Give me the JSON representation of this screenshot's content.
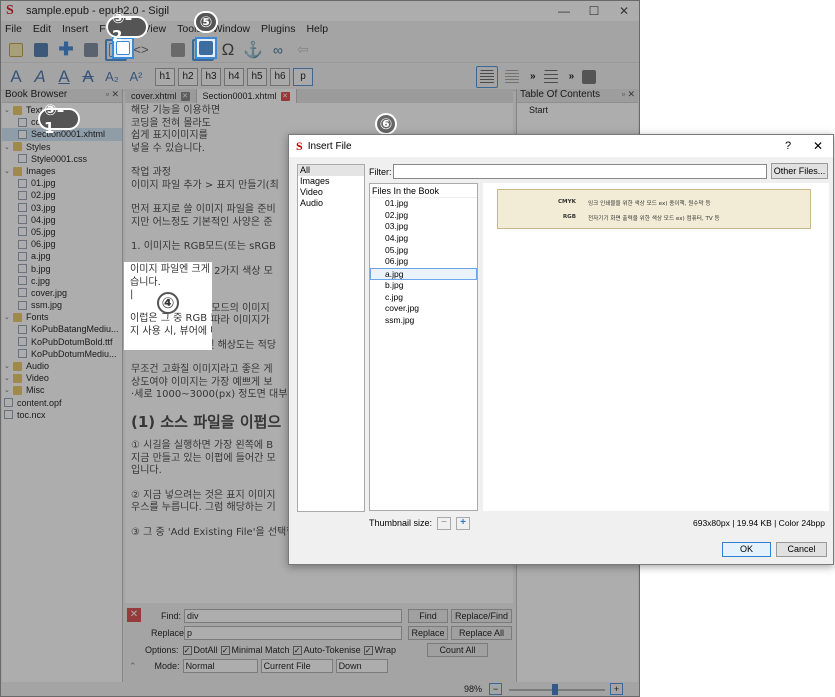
{
  "window": {
    "title": "sample.epub - epub2.0 - Sigil",
    "minimize": "—",
    "maximize": "☐",
    "close": "✕"
  },
  "menu": [
    "File",
    "Edit",
    "Insert",
    "Format",
    "View",
    "Tools",
    "Window",
    "Plugins",
    "Help"
  ],
  "toolbar2": {
    "headings": [
      "h1",
      "h2",
      "h3",
      "h4",
      "h5",
      "h6",
      "p"
    ]
  },
  "book_browser": {
    "title": "Book Browser",
    "items": [
      {
        "label": "Text",
        "type": "folder",
        "level": 0
      },
      {
        "label": "cover.xhtml",
        "type": "file",
        "level": 1
      },
      {
        "label": "Section0001.xhtml",
        "type": "file",
        "level": 1,
        "selected": true
      },
      {
        "label": "Styles",
        "type": "folder",
        "level": 0
      },
      {
        "label": "Style0001.css",
        "type": "file",
        "level": 1
      },
      {
        "label": "Images",
        "type": "folder",
        "level": 0
      },
      {
        "label": "01.jpg",
        "type": "file",
        "level": 1
      },
      {
        "label": "02.jpg",
        "type": "file",
        "level": 1
      },
      {
        "label": "03.jpg",
        "type": "file",
        "level": 1
      },
      {
        "label": "04.jpg",
        "type": "file",
        "level": 1
      },
      {
        "label": "05.jpg",
        "type": "file",
        "level": 1
      },
      {
        "label": "06.jpg",
        "type": "file",
        "level": 1
      },
      {
        "label": "a.jpg",
        "type": "file",
        "level": 1
      },
      {
        "label": "b.jpg",
        "type": "file",
        "level": 1
      },
      {
        "label": "c.jpg",
        "type": "file",
        "level": 1
      },
      {
        "label": "cover.jpg",
        "type": "file",
        "level": 1
      },
      {
        "label": "ssm.jpg",
        "type": "file",
        "level": 1
      },
      {
        "label": "Fonts",
        "type": "folder",
        "level": 0
      },
      {
        "label": "KoPubBatangMediu...",
        "type": "file",
        "level": 1
      },
      {
        "label": "KoPubDotumBold.ttf",
        "type": "file",
        "level": 1
      },
      {
        "label": "KoPubDotumMediu...",
        "type": "file",
        "level": 1
      },
      {
        "label": "Audio",
        "type": "folder",
        "level": 0
      },
      {
        "label": "Video",
        "type": "folder",
        "level": 0
      },
      {
        "label": "Misc",
        "type": "folder",
        "level": 0
      },
      {
        "label": "content.opf",
        "type": "file",
        "level": 0
      },
      {
        "label": "toc.ncx",
        "type": "file",
        "level": 0
      }
    ]
  },
  "editor": {
    "tabs": [
      {
        "label": "cover.xhtml",
        "active": false
      },
      {
        "label": "Section0001.xhtml",
        "active": true
      }
    ],
    "lines": [
      [
        "해당 기능을 이용하면",
        "코딩을 전혀 몰라도",
        "쉽게 표지이미지를",
        "넣을 수 있습니다."
      ],
      [
        "작업 과정",
        "이미지 파일 추가 > 표지 만들기(최"
      ],
      [
        "먼저 표지로 쓸 이미지 파일을 준비",
        "지만 어느정도 기본적인 사양은 준"
      ],
      [
        "1. 이미지는 RGB모드(또는 sRGB"
      ],
      [
        "이미지 파일엔 크게 2가지 색상 모",
        "습니다."
      ],
      [
        "이럽은 그 중 RGB 모드의 이미지",
        "지 사용 시, 뷰어에 따라 이미지가"
      ],
      [
        "2. 이미지의 크기 및 해상도는 적당"
      ],
      [
        "무조건 고화질 이미지라고 좋은 게",
        "상도여야 이미지는 가장 예쁘게 보",
        "·세로 1000~3000(px) 정도면 대부"
      ]
    ],
    "heading": "(1) 소스 파일을 이펍으",
    "lines2": [
      [
        "① 시길을 실행하면 가장 왼쪽에 B",
        "지금 만들고 있는 이펍에 들어간 모",
        "입니다."
      ],
      [
        "② 지금 넣으려는 것은 표지 이미지",
        "우스를 누릅니다. 그럼 해당하는 기"
      ],
      [
        "③ 그 중 'Add Existing File'을 선택합니다."
      ]
    ]
  },
  "find_bar": {
    "find_label": "Find:",
    "find_value": "div",
    "replace_label": "Replace:",
    "replace_value": "p",
    "find_btn": "Find",
    "replace_find_btn": "Replace/Find",
    "replace_btn": "Replace",
    "replace_all_btn": "Replace All",
    "count_all_btn": "Count All",
    "options_label": "Options:",
    "options": [
      "DotAll",
      "Minimal Match",
      "Auto-Tokenise",
      "Wrap"
    ],
    "mode_label": "Mode:",
    "mode_value": "Normal",
    "scope_value": "Current File",
    "direction_value": "Down"
  },
  "toc": {
    "title": "Table Of Contents",
    "items": [
      "Start"
    ]
  },
  "status": {
    "zoom": "98%"
  },
  "callouts": {
    "c31": "③–1",
    "c32": "③–2",
    "c4": "④",
    "c5": "⑤",
    "c6": "⑥"
  },
  "dialog": {
    "title": "Insert File",
    "help": "?",
    "close": "✕",
    "categories": [
      "All",
      "Images",
      "Video",
      "Audio"
    ],
    "filter_label": "Filter:",
    "filter_value": "",
    "other_files_btn": "Other Files...",
    "files_header": "Files In the Book",
    "files": [
      "01.jpg",
      "02.jpg",
      "03.jpg",
      "04.jpg",
      "05.jpg",
      "06.jpg",
      "a.jpg",
      "b.jpg",
      "c.jpg",
      "cover.jpg",
      "ssm.jpg"
    ],
    "selected_file": "a.jpg",
    "preview_rows": [
      {
        "key": "CMYK",
        "text": "잉크 인쇄물을 위한 색상 모드 ex) 종이책, 원수막 등"
      },
      {
        "key": "RGB",
        "text": "전자기기 화면 출력을 위한 색상 모드 ex) 컴퓨터, TV 등"
      }
    ],
    "thumbnail_label": "Thumbnail size:",
    "info": "693x80px | 19.94 KB | Color 24bpp",
    "ok": "OK",
    "cancel": "Cancel"
  },
  "colors": {
    "accent": "#3e88d8",
    "overlay": "#3c3c3c",
    "preview_bg": "#f2ecd6"
  }
}
